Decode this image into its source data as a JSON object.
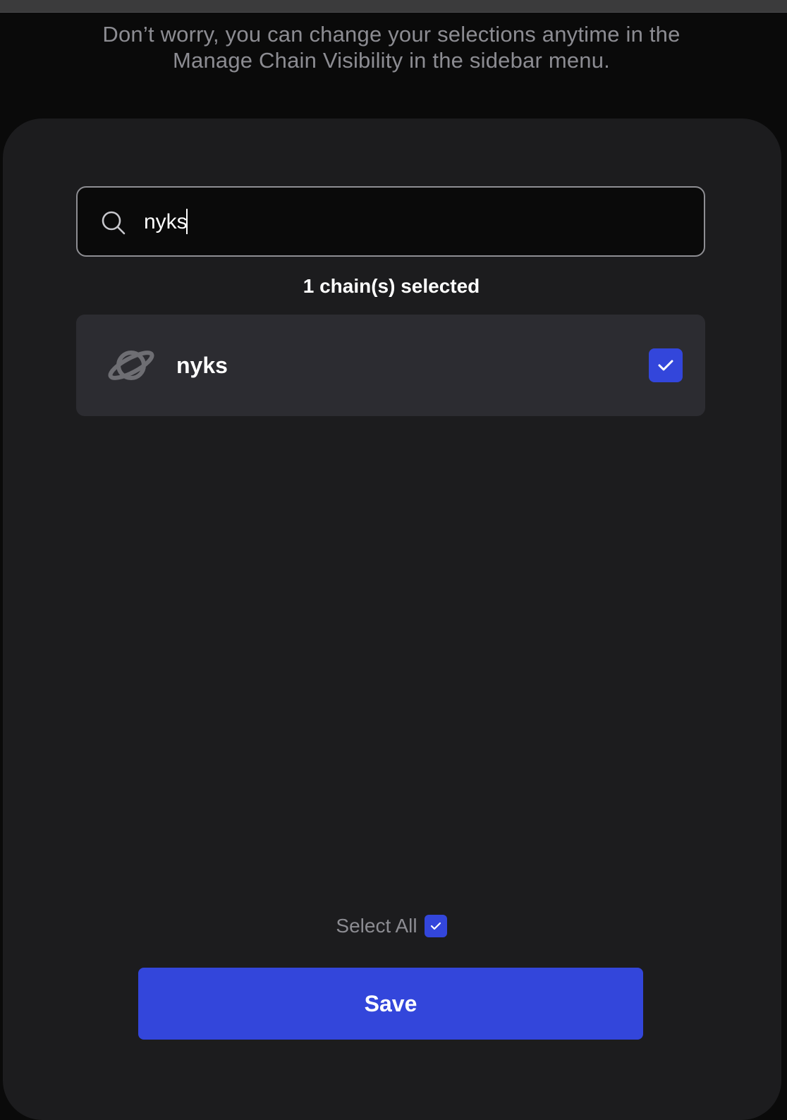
{
  "colors": {
    "accent": "#3346db",
    "background": "#0a0a0a",
    "card": "#1c1c1e",
    "row": "#2c2c31",
    "muted_text": "#8c8c92"
  },
  "header": {
    "subtitle_line1": "Don’t worry, you can change your selections anytime in the",
    "subtitle_line2": "Manage Chain Visibility in the sidebar menu."
  },
  "search": {
    "icon": "search-icon",
    "value": "nyks"
  },
  "selection": {
    "count_text": "1 chain(s) selected"
  },
  "chains": [
    {
      "name": "nyks",
      "icon": "planet-icon",
      "checked": true
    }
  ],
  "footer": {
    "select_all_label": "Select All",
    "select_all_checked": true,
    "save_label": "Save"
  }
}
